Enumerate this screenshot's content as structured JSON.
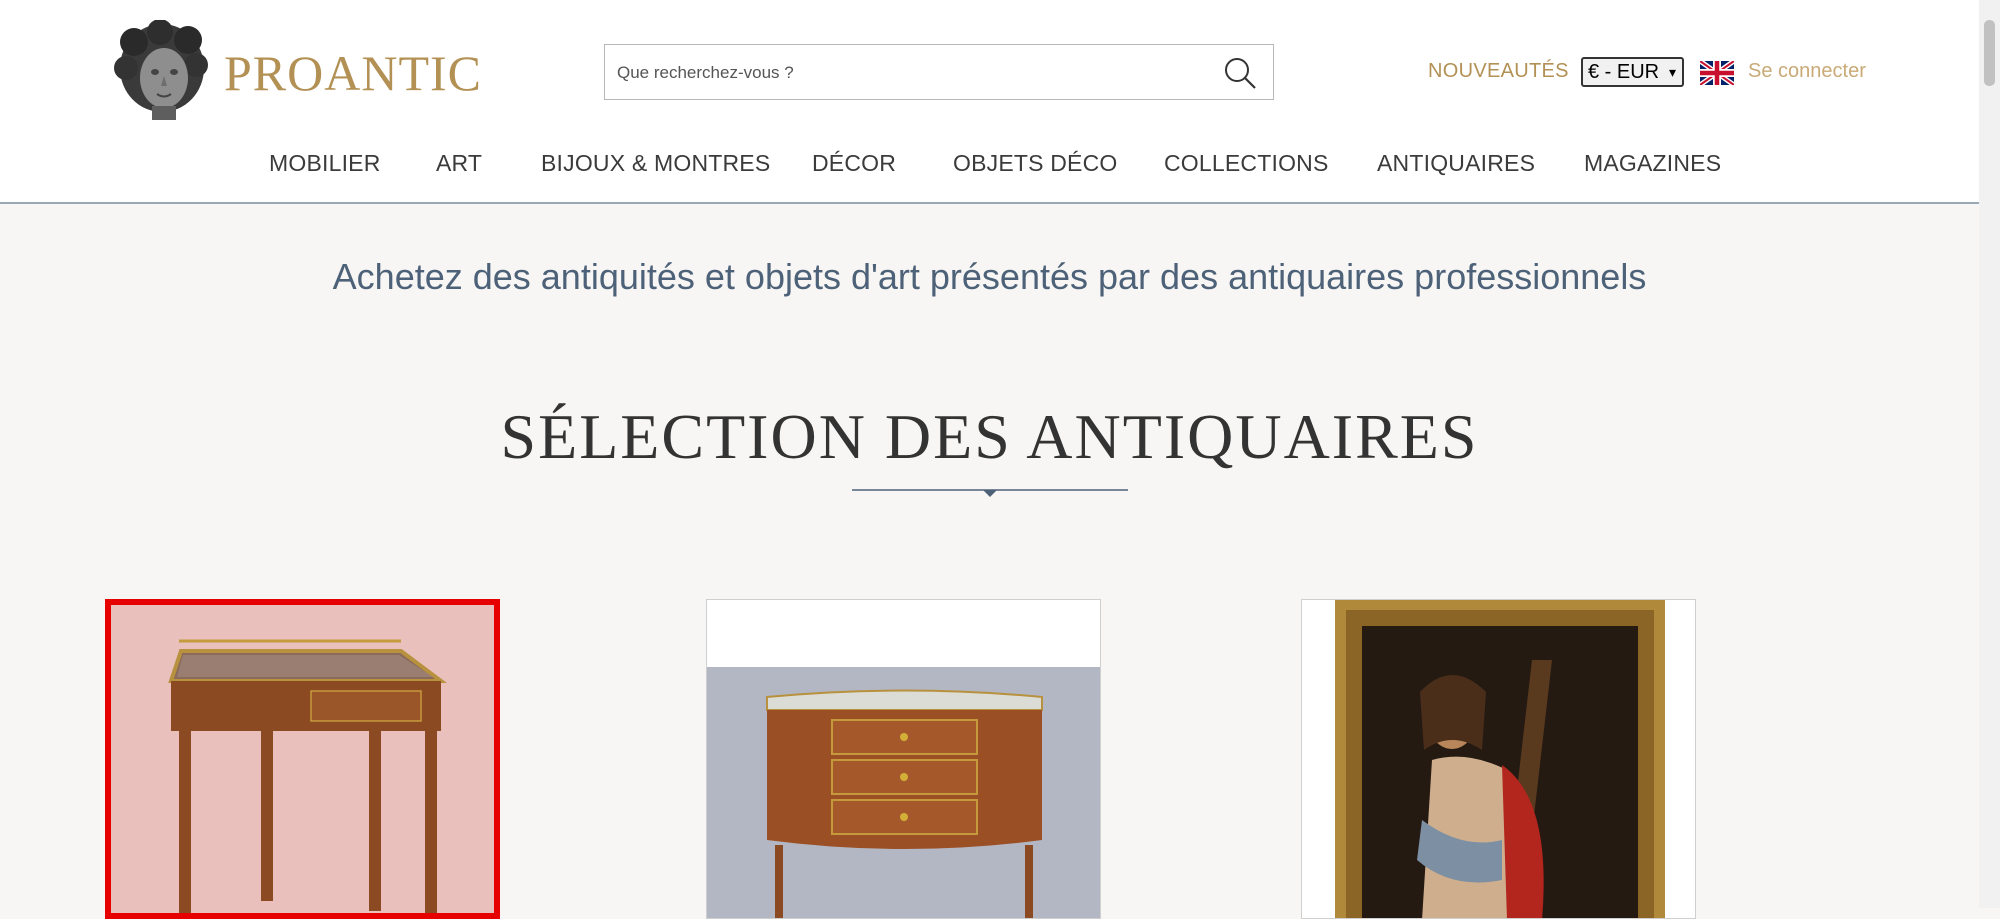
{
  "header": {
    "brand": "PROANTIC",
    "search": {
      "placeholder": "Que recherchez-vous ?",
      "value": ""
    },
    "nouveautes": "NOUVEAUTÉS",
    "currency": "€ - EUR",
    "login": "Se connecter"
  },
  "nav": [
    {
      "label": "MOBILIER"
    },
    {
      "label": "ART"
    },
    {
      "label": "BIJOUX & MONTRES"
    },
    {
      "label": "DÉCOR"
    },
    {
      "label": "OBJETS DÉCO"
    },
    {
      "label": "COLLECTIONS"
    },
    {
      "label": "ANTIQUAIRES"
    },
    {
      "label": "MAGAZINES"
    }
  ],
  "main": {
    "tagline": "Achetez des antiquités et objets d'art présentés par des antiquaires professionnels",
    "section_title": "SÉLECTION DES ANTIQUAIRES"
  },
  "icons": {
    "logo": "cherub-head-icon",
    "search": "search-icon",
    "flag": "uk-flag-icon"
  },
  "colors": {
    "brand_gold": "#b39155",
    "login_gold": "#c9aa77",
    "tagline_blue": "#4d6278",
    "selected_border": "#e60000"
  }
}
